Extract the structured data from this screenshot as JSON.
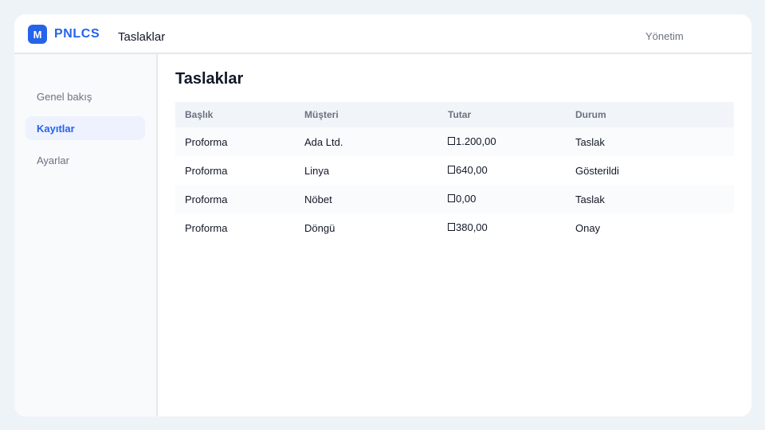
{
  "app": {
    "logo_letter": "M",
    "brand": "PNLCS",
    "top_title": "Taslaklar",
    "top_right": "Yönetim"
  },
  "sidebar": {
    "items": [
      {
        "label": "Genel bakış",
        "active": false
      },
      {
        "label": "Kayıtlar",
        "active": true
      },
      {
        "label": "Ayarlar",
        "active": false
      }
    ]
  },
  "main": {
    "title": "Taslaklar",
    "table": {
      "columns": [
        "Başlık",
        "Müşteri",
        "Tutar",
        "Durum"
      ],
      "rows": [
        {
          "title": "Proforma",
          "customer": "Ada Ltd.",
          "amount": "1.200,00",
          "status": "Taslak"
        },
        {
          "title": "Proforma",
          "customer": "Linya",
          "amount": "640,00",
          "status": "Gösterildi"
        },
        {
          "title": "Proforma",
          "customer": "Nöbet",
          "amount": "0,00",
          "status": "Taslak"
        },
        {
          "title": "Proforma",
          "customer": "Döngü",
          "amount": "380,00",
          "status": "Onay"
        }
      ]
    }
  },
  "colors": {
    "accent": "#2563eb",
    "background": "#eef3f8",
    "sidebar_bg": "#f8fafc",
    "header_row_bg": "#f1f5f9"
  }
}
